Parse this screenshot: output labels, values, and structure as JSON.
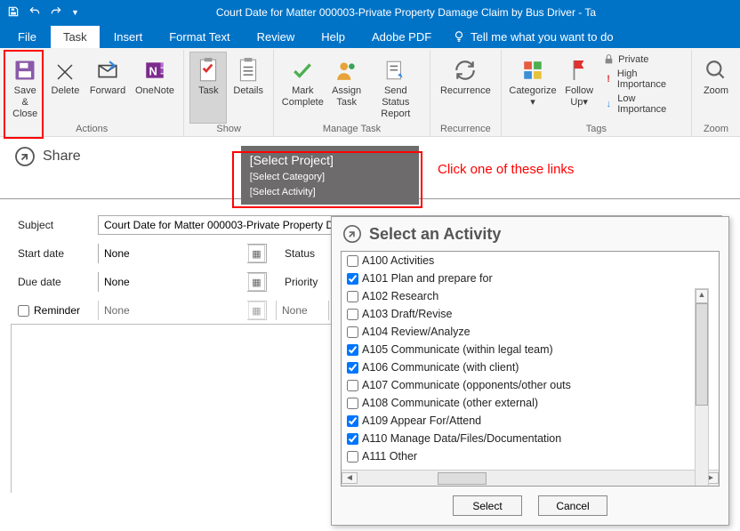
{
  "title": "Court Date for Matter 000003-Private Property Damage Claim by Bus Driver  -  Ta",
  "menu": {
    "file": "File",
    "task": "Task",
    "insert": "Insert",
    "format": "Format Text",
    "review": "Review",
    "help": "Help",
    "adobe": "Adobe PDF",
    "tell": "Tell me what you want to do"
  },
  "ribbon": {
    "save_close": "Save &\nClose",
    "delete": "Delete",
    "forward": "Forward",
    "onenote": "OneNote",
    "task": "Task",
    "details": "Details",
    "mark": "Mark\nComplete",
    "assign": "Assign\nTask",
    "send": "Send Status\nReport",
    "recurrence": "Recurrence",
    "categorize": "Categorize",
    "followup": "Follow\nUp",
    "private": "Private",
    "high": "High Importance",
    "low": "Low Importance",
    "zoom": "Zoom",
    "g_actions": "Actions",
    "g_show": "Show",
    "g_manage": "Manage Task",
    "g_recur": "Recurrence",
    "g_tags": "Tags",
    "g_zoom": "Zoom"
  },
  "share": "Share",
  "project_box": {
    "p": "[Select Project]",
    "c": "[Select Category]",
    "a": "[Select Activity]"
  },
  "annotation": "Click one of these links",
  "form": {
    "subject_label": "Subject",
    "subject_value": "Court Date for Matter 000003-Private Property Da",
    "start_label": "Start date",
    "due_label": "Due date",
    "none": "None",
    "status_label": "Status",
    "priority_label": "Priority",
    "reminder_label": "Reminder"
  },
  "dialog": {
    "title": "Select an Activity",
    "items": [
      {
        "c": false,
        "t": "A100 Activities"
      },
      {
        "c": true,
        "t": "A101 Plan and prepare for"
      },
      {
        "c": false,
        "t": "A102 Research"
      },
      {
        "c": false,
        "t": "A103 Draft/Revise"
      },
      {
        "c": false,
        "t": "A104 Review/Analyze"
      },
      {
        "c": true,
        "t": "A105 Communicate (within legal team)"
      },
      {
        "c": true,
        "t": "A106 Communicate (with client)"
      },
      {
        "c": false,
        "t": "A107 Communicate (opponents/other outs"
      },
      {
        "c": false,
        "t": "A108 Communicate (other external)"
      },
      {
        "c": true,
        "t": "A109 Appear For/Attend"
      },
      {
        "c": true,
        "t": "A110 Manage Data/Files/Documentation"
      },
      {
        "c": false,
        "t": "A111 Other"
      }
    ],
    "select": "Select",
    "cancel": "Cancel"
  }
}
